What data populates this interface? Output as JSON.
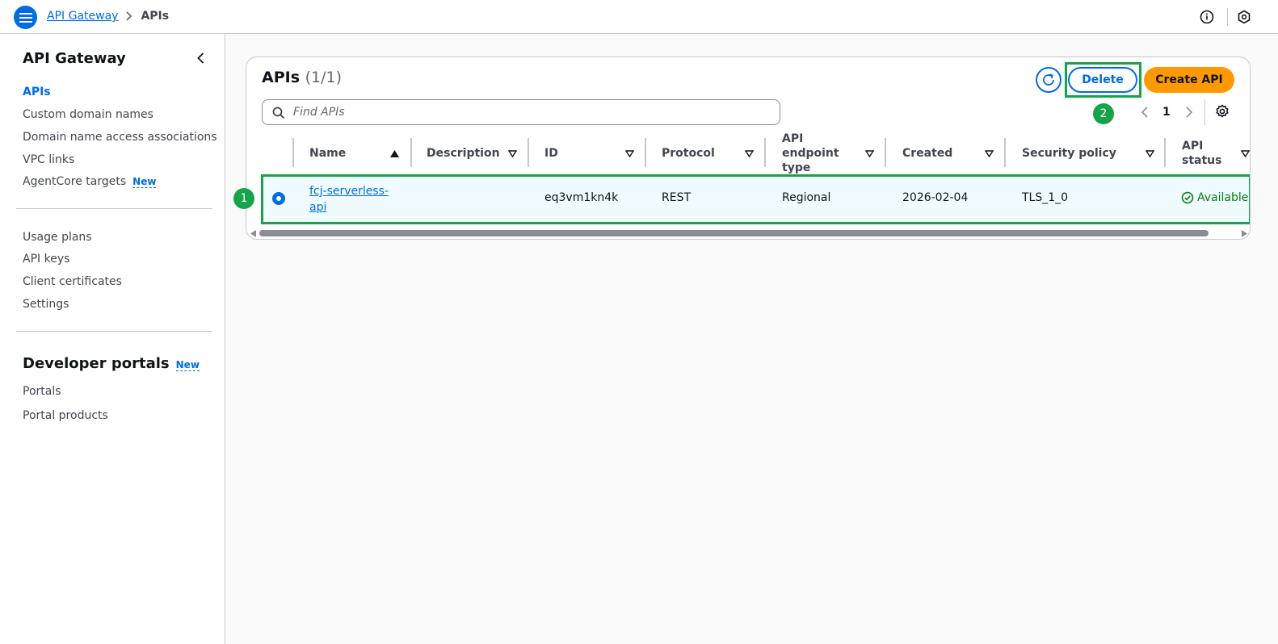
{
  "topbar": {
    "breadcrumb_root": "API Gateway",
    "breadcrumb_current": "APIs",
    "icons": [
      "menu-icon",
      "chevron-right-icon",
      "info-icon",
      "notifications-icon"
    ]
  },
  "sidebar": {
    "title": "API Gateway",
    "items": [
      {
        "label": "APIs",
        "active": true
      },
      {
        "label": "Custom domain names"
      },
      {
        "label": "Domain name access associations"
      },
      {
        "label": "VPC links"
      },
      {
        "label": "AgentCore targets",
        "badge": "New"
      }
    ],
    "items2": [
      {
        "label": "Usage plans"
      },
      {
        "label": "API keys"
      },
      {
        "label": "Client certificates"
      },
      {
        "label": "Settings"
      }
    ],
    "developer_portals": {
      "title": "Developer portals",
      "badge": "New",
      "items": [
        {
          "label": "Portals"
        },
        {
          "label": "Portal products"
        }
      ]
    }
  },
  "panel": {
    "title": "APIs",
    "count": "(1/1)",
    "delete_label": "Delete",
    "create_label": "Create API",
    "search_placeholder": "Find APIs",
    "page_number": "1",
    "step_badges": [
      "1",
      "2"
    ]
  },
  "table": {
    "columns": [
      "Name",
      "Description",
      "ID",
      "Protocol",
      "API endpoint type",
      "Created",
      "Security policy",
      "API status"
    ],
    "rows": [
      {
        "name": "fcj-serverless-api",
        "description": "",
        "id": "eq3vm1kn4k",
        "protocol": "REST",
        "endpoint_type": "Regional",
        "created": "2026-02-04",
        "security_policy": "TLS_1_0",
        "status": "Available",
        "selected": true
      }
    ]
  },
  "colors": {
    "primary": "#006ce0",
    "accent": "#ff9900",
    "highlight": "#16a34a",
    "success": "#037f0c"
  }
}
